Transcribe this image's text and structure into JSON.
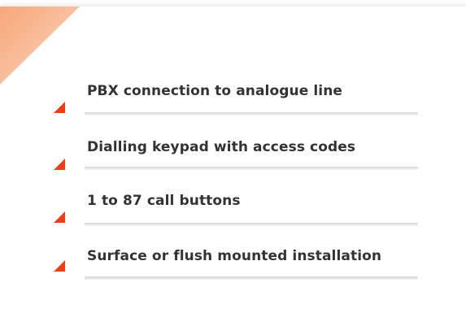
{
  "features": {
    "items": [
      {
        "label": "PBX connection to analogue line"
      },
      {
        "label": "Dialling keypad with access codes"
      },
      {
        "label": "1 to 87 call buttons"
      },
      {
        "label": "Surface or flush mounted installation"
      }
    ]
  },
  "colors": {
    "accent": "#e8401a",
    "corner": "#f9b48a",
    "text": "#333333",
    "rule": "#dddddd"
  }
}
